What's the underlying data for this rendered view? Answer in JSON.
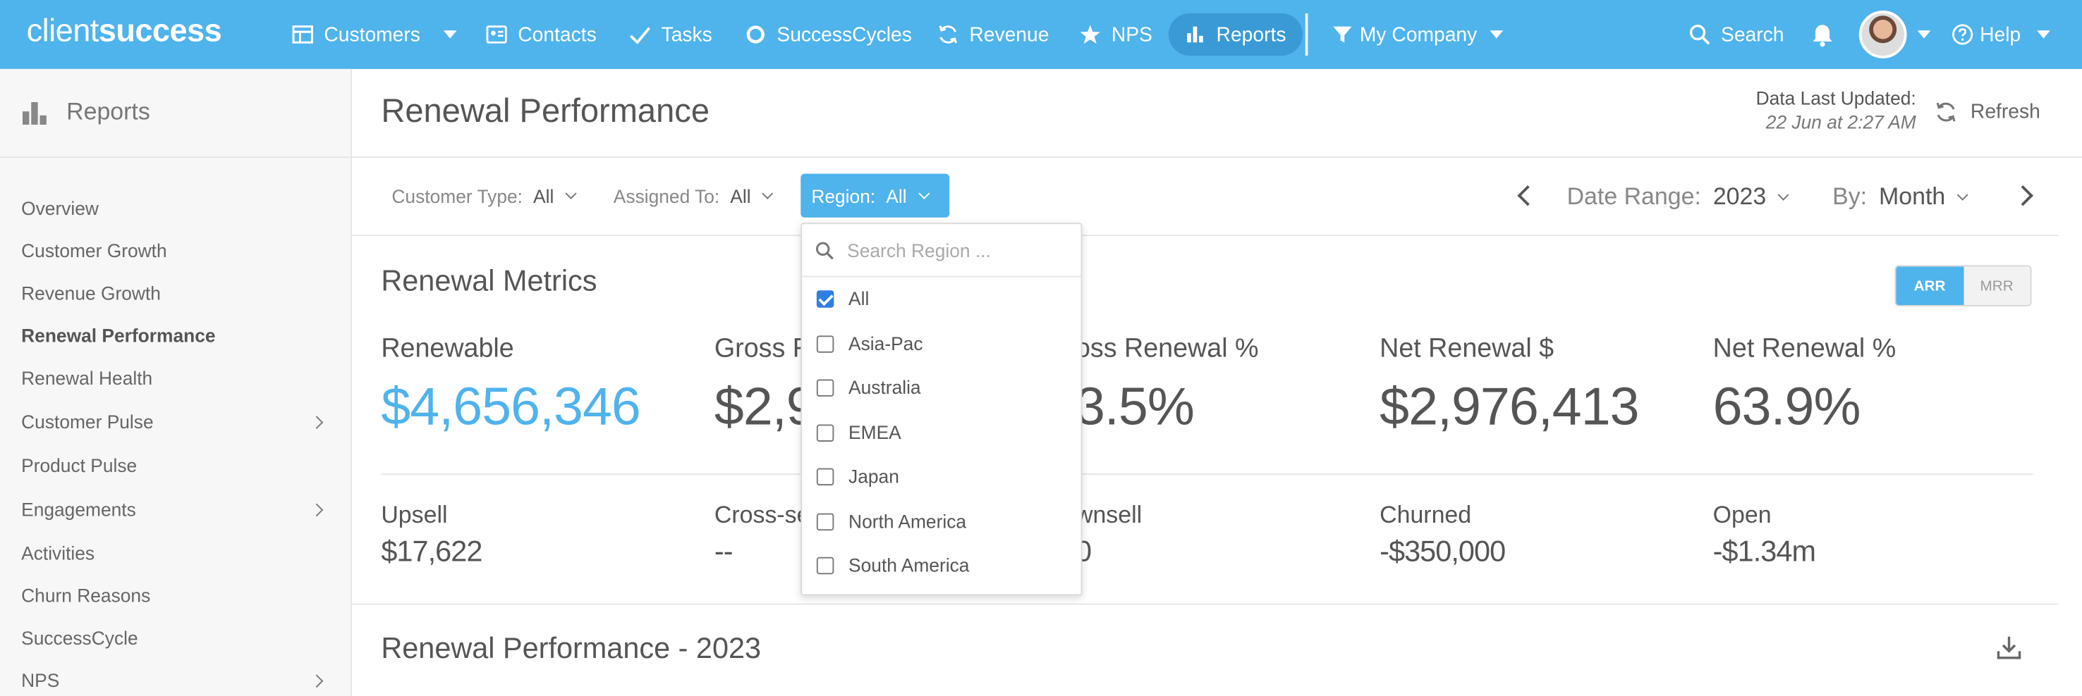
{
  "topnav": {
    "logo_light": "client",
    "logo_bold": "success",
    "items": [
      {
        "label": "Customers"
      },
      {
        "label": "Contacts"
      },
      {
        "label": "Tasks"
      },
      {
        "label": "SuccessCycles"
      },
      {
        "label": "Revenue"
      },
      {
        "label": "NPS"
      },
      {
        "label": "Reports"
      }
    ],
    "company": "My Company",
    "search": "Search",
    "help": "Help"
  },
  "sidebar": {
    "title": "Reports",
    "items": [
      {
        "label": "Overview"
      },
      {
        "label": "Customer Growth"
      },
      {
        "label": "Revenue Growth"
      },
      {
        "label": "Renewal Performance"
      },
      {
        "label": "Renewal Health"
      },
      {
        "label": "Customer Pulse"
      },
      {
        "label": "Product Pulse"
      },
      {
        "label": "Engagements"
      },
      {
        "label": "Activities"
      },
      {
        "label": "Churn Reasons"
      },
      {
        "label": "SuccessCycle"
      },
      {
        "label": "NPS"
      }
    ]
  },
  "header": {
    "title": "Renewal Performance",
    "updated_label": "Data Last Updated:",
    "updated_value": "22 Jun at 2:27 AM",
    "refresh": "Refresh"
  },
  "filters": {
    "customer_type_label": "Customer Type:",
    "customer_type_value": "All",
    "assigned_label": "Assigned To:",
    "assigned_value": "All",
    "region_label": "Region:",
    "region_value": "All",
    "date_range_label": "Date Range:",
    "date_range_value": "2023",
    "by_label": "By:",
    "by_value": "Month"
  },
  "metrics": {
    "title": "Renewal Metrics",
    "toggle_on": "ARR",
    "toggle_off": "MRR",
    "renewable_label": "Renewable",
    "renewable_value": "$4,656,346",
    "gross_label": "Gross Renewal $",
    "gross_value": "$2,9",
    "gross_pct_label": "oss Renewal %",
    "gross_pct_value": "3.5%",
    "net_label": "Net Renewal $",
    "net_value": "$2,976,413",
    "net_pct_label": "Net Renewal %",
    "net_pct_value": "63.9%",
    "upsell_label": "Upsell",
    "upsell_value": "$17,622",
    "cross_label": "Cross-se",
    "cross_value": "--",
    "down_label": "wnsell",
    "down_value": "0",
    "churned_label": "Churned",
    "churned_value": "-$350,000",
    "open_label": "Open",
    "open_value": "-$1.34m"
  },
  "section2": {
    "title": "Renewal Performance - 2023"
  },
  "region_dropdown": {
    "placeholder": "Search Region ...",
    "options": [
      {
        "label": "All",
        "checked": true
      },
      {
        "label": "Asia-Pac",
        "checked": false
      },
      {
        "label": "Australia",
        "checked": false
      },
      {
        "label": "EMEA",
        "checked": false
      },
      {
        "label": "Japan",
        "checked": false
      },
      {
        "label": "North America",
        "checked": false
      },
      {
        "label": "South America",
        "checked": false
      }
    ]
  },
  "colors": {
    "accent": "#4fb3ec",
    "checkbox": "#2f7fe0"
  }
}
